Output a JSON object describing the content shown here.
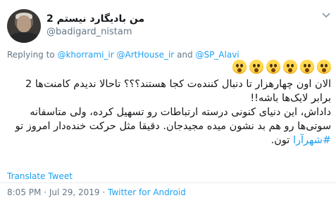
{
  "author": {
    "display_name": "من بادیگارد نیستم 2",
    "handle": "@badigard_nistam"
  },
  "reply_to": {
    "prefix": "Replying to ",
    "users": [
      "@khorrami_ir",
      "@ArtHouse_ir",
      "@SP_Alavi"
    ],
    "sep1": " ",
    "sep2": " and "
  },
  "emoji_icons": [
    "astonished-face-icon",
    "astonished-face-icon",
    "astonished-face-icon",
    "astonished-face-icon",
    "astonished-face-icon",
    "astonished-face-icon"
  ],
  "tweet": {
    "line1": "الان اون چهارهزار تا دنبال کنندەت کجا هستند؟؟؟ تاحالا ندیدم کامنت‌ها 2 برابر لایک‌ها باشه!!",
    "line2_text": "داداش، این دنیای کنونی درسته ارتباطات رو تسهیل کرده، ولی متاسفانه سوتی‌ها رو هم بد نشون میده مجیدجان. دقیقا مثل حرکت خنده‌دار امروز تو ",
    "hashtag": "#شهرآرا",
    "line2_end": " تون."
  },
  "translate_label": "Translate Tweet",
  "meta": {
    "time": "8:05 PM",
    "sep": " · ",
    "date": "Jul 29, 2019",
    "sep2": " · ",
    "source": "Twitter for Android"
  },
  "colors": {
    "link": "#1da1f2",
    "muted": "#657786",
    "text": "#14171a"
  }
}
